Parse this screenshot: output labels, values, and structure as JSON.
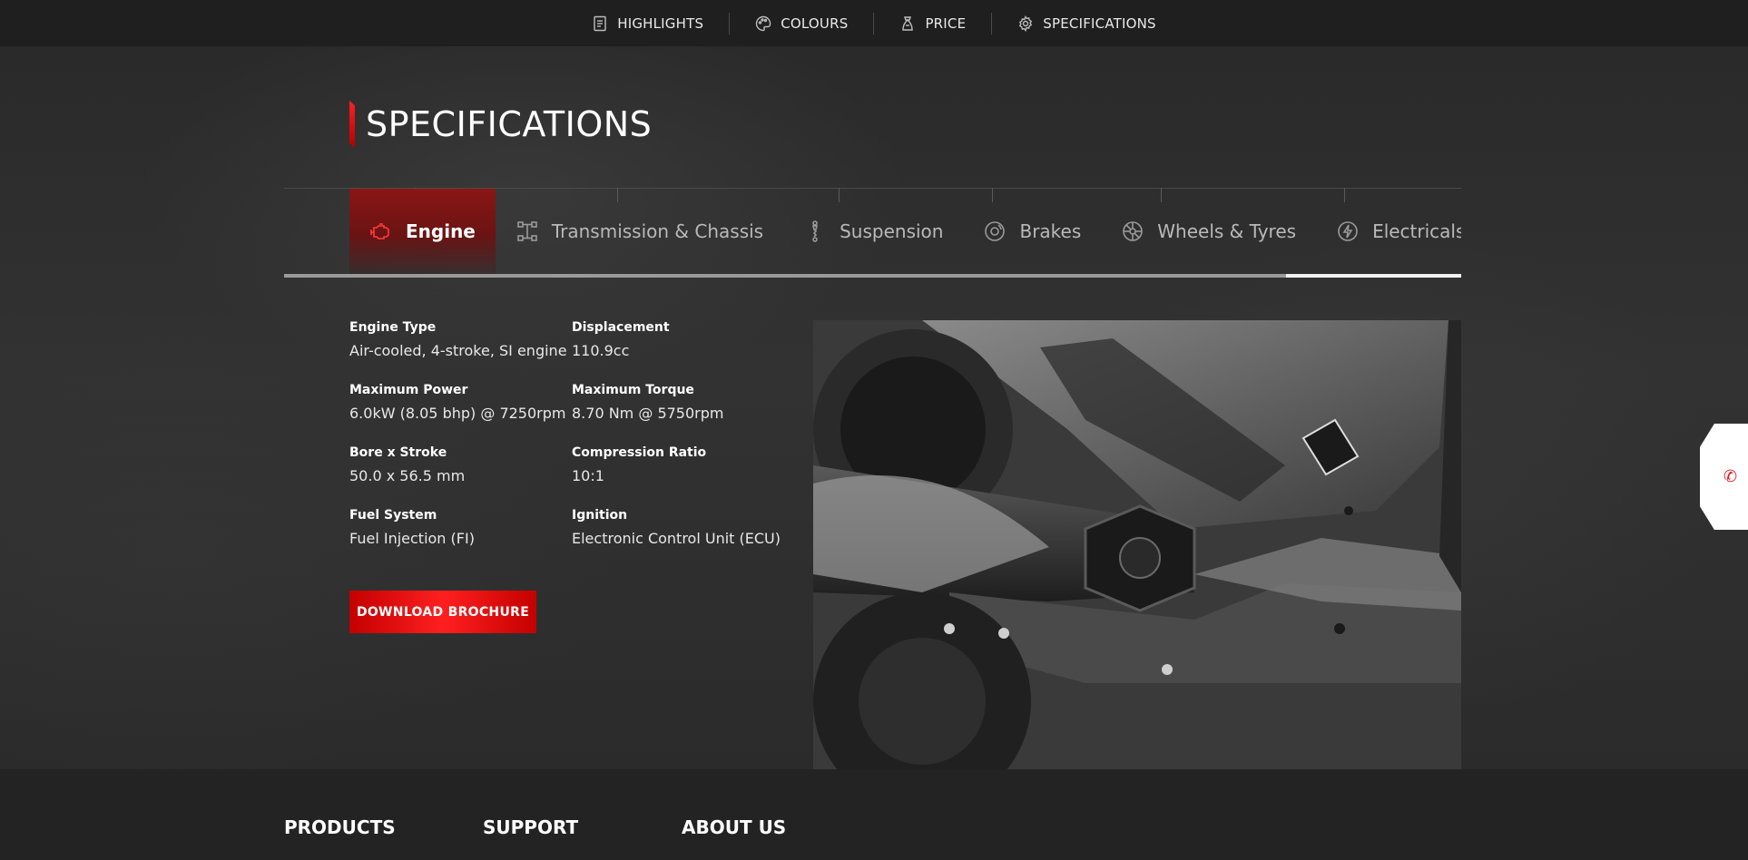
{
  "topnav": {
    "items": [
      {
        "label": "HIGHLIGHTS",
        "icon": "document-icon"
      },
      {
        "label": "COLOURS",
        "icon": "palette-icon"
      },
      {
        "label": "PRICE",
        "icon": "price-icon"
      },
      {
        "label": "SPECIFICATIONS",
        "icon": "gear-icon"
      }
    ]
  },
  "section": {
    "title": "SPECIFICATIONS"
  },
  "tabs": [
    {
      "label": "Engine",
      "icon": "engine-icon",
      "active": true
    },
    {
      "label": "Transmission & Chassis",
      "icon": "chassis-icon",
      "active": false
    },
    {
      "label": "Suspension",
      "icon": "suspension-icon",
      "active": false
    },
    {
      "label": "Brakes",
      "icon": "brake-disc-icon",
      "active": false
    },
    {
      "label": "Wheels & Tyres",
      "icon": "wheel-icon",
      "active": false
    },
    {
      "label": "Electricals",
      "icon": "lightning-icon",
      "active": false
    },
    {
      "label": "",
      "icon": "partial-icon",
      "active": false
    }
  ],
  "specs": [
    {
      "label": "Engine Type",
      "value": "Air-cooled, 4-stroke, SI engine"
    },
    {
      "label": "Displacement",
      "value": "110.9cc"
    },
    {
      "label": "Maximum Power",
      "value": "6.0kW (8.05 bhp) @ 7250rpm"
    },
    {
      "label": "Maximum Torque",
      "value": "8.70 Nm @ 5750rpm"
    },
    {
      "label": "Bore x Stroke",
      "value": "50.0 x 56.5 mm"
    },
    {
      "label": "Compression Ratio",
      "value": "10:1"
    },
    {
      "label": "Fuel System",
      "value": "Fuel Injection (FI)"
    },
    {
      "label": "Ignition",
      "value": "Electronic Control Unit (ECU)"
    }
  ],
  "download_button": "DOWNLOAD BROCHURE",
  "footer": {
    "columns": [
      "PRODUCTS",
      "SUPPORT",
      "ABOUT US"
    ]
  },
  "colors": {
    "accent": "#e21b1b",
    "background": "#2b2b2b",
    "nav_background": "#1f1f1f"
  }
}
